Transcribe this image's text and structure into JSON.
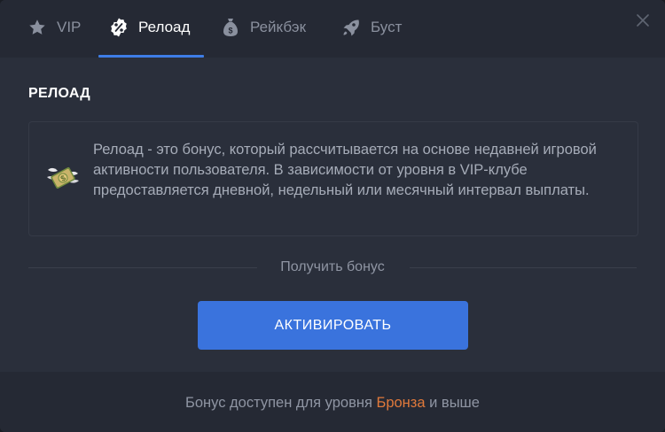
{
  "tabs": [
    {
      "label": "VIP",
      "icon": "star-icon",
      "active": false
    },
    {
      "label": "Релоад",
      "icon": "percent-badge-icon",
      "active": true
    },
    {
      "label": "Рейкбэк",
      "icon": "money-bag-icon",
      "active": false
    },
    {
      "label": "Буст",
      "icon": "rocket-icon",
      "active": false
    }
  ],
  "section": {
    "title": "РЕЛОАД",
    "description": "Релоад - это бонус, который рассчитывается на основе недавней игровой активности пользователя. В зависимости от уровня в VIP-клубе предоставляется дневной, недельный или месячный интервал выплаты."
  },
  "divider_label": "Получить бонус",
  "activate_button": "АКТИВИРОВАТЬ",
  "footer": {
    "prefix": "Бонус доступен для уровня",
    "level": "Бронза",
    "suffix": "и выше"
  },
  "colors": {
    "accent": "#3a73dd",
    "level": "#e0793b",
    "active_tab_underline": "#3e7de6"
  }
}
